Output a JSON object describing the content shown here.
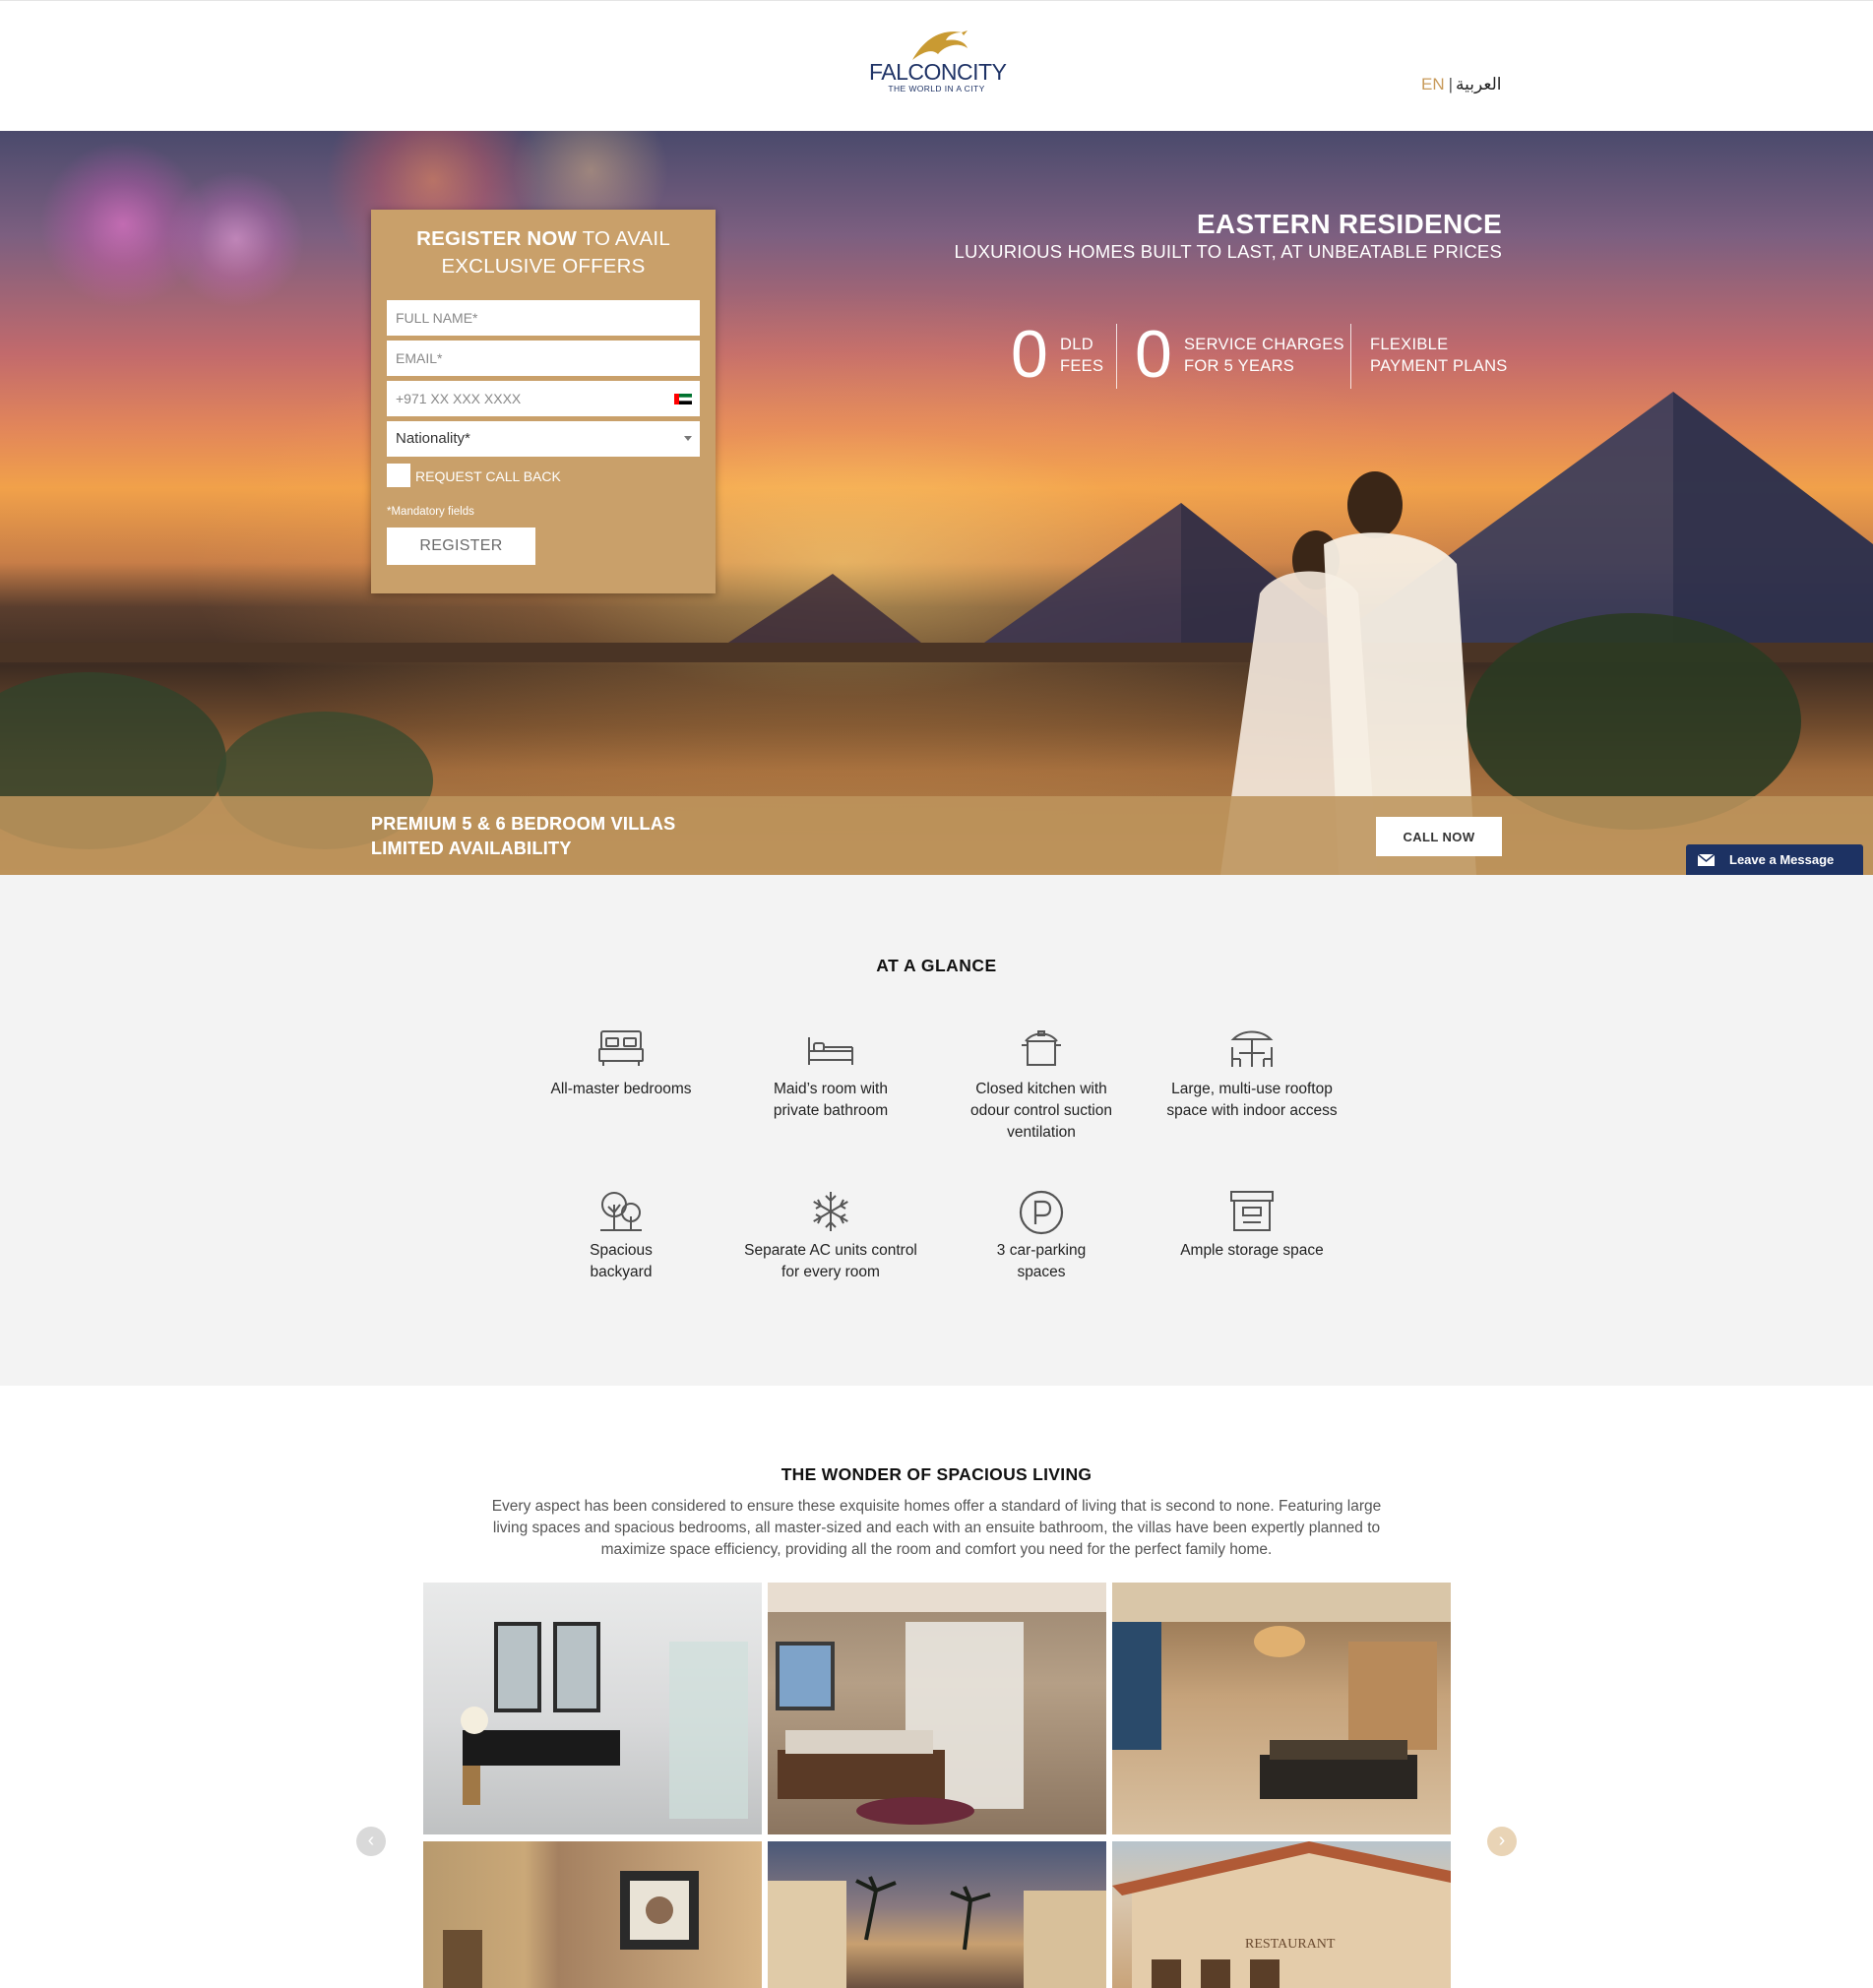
{
  "header": {
    "logo_name": "FALCONCITY",
    "logo_tagline": "THE WORLD IN A CITY",
    "lang_en": "EN",
    "lang_ar": "العربية"
  },
  "form": {
    "title_bold": "REGISTER NOW",
    "title_rest": " TO AVAIL EXCLUSIVE OFFERS",
    "fullname_placeholder": "FULL NAME*",
    "email_placeholder": "EMAIL*",
    "phone_placeholder": "+971 XX XXX XXXX",
    "nationality_selected": "Nationality*",
    "callback_label": "REQUEST CALL BACK",
    "mandatory_note": "*Mandatory fields",
    "submit_label": "REGISTER"
  },
  "hero": {
    "title": "EASTERN RESIDENCE",
    "subtitle": "LUXURIOUS HOMES BUILT TO LAST, AT UNBEATABLE PRICES",
    "stats": [
      {
        "num": "0",
        "line1": "DLD",
        "line2": "FEES"
      },
      {
        "num": "0",
        "line1": "SERVICE CHARGES",
        "line2": "FOR 5 YEARS"
      },
      {
        "num": "",
        "line1": "FLEXIBLE",
        "line2": "PAYMENT PLANS"
      }
    ],
    "band_line1": "PREMIUM 5 & 6 BEDROOM VILLAS",
    "band_line2": "LIMITED AVAILABILITY",
    "call_label": "CALL NOW",
    "leave_message": "Leave a Message"
  },
  "glance": {
    "title": "AT A GLANCE",
    "features": [
      {
        "icon": "bed-icon",
        "line1": "All-master bedrooms",
        "line2": "",
        "line3": ""
      },
      {
        "icon": "single-bed-icon",
        "line1": "Maid’s room with",
        "line2": "private bathroom",
        "line3": ""
      },
      {
        "icon": "cooking-pot-icon",
        "line1": "Closed kitchen with",
        "line2": "odour control suction",
        "line3": "ventilation"
      },
      {
        "icon": "rooftop-table-icon",
        "line1": "Large, multi-use rooftop",
        "line2": "space with indoor access",
        "line3": ""
      },
      {
        "icon": "trees-icon",
        "line1": "Spacious",
        "line2": "backyard",
        "line3": ""
      },
      {
        "icon": "snowflake-icon",
        "line1": "Separate AC units control",
        "line2": "for every room",
        "line3": ""
      },
      {
        "icon": "parking-icon",
        "line1": "3 car-parking",
        "line2": "spaces",
        "line3": ""
      },
      {
        "icon": "storage-box-icon",
        "line1": "Ample storage space",
        "line2": "",
        "line3": ""
      }
    ]
  },
  "wonder": {
    "title": "THE WONDER OF SPACIOUS LIVING",
    "text": "Every aspect has been considered to ensure these exquisite homes offer a standard of living that is second to none. Featuring large living spaces and spacious bedrooms, all master-sized and each with an ensuite bathroom, the villas have been expertly planned to maximize space efficiency, providing all the room and comfort you need for the perfect family home.",
    "arrow_prev": "‹",
    "arrow_next": "›",
    "restaurant_sign": "RESTAURANT"
  },
  "colors": {
    "gold": "#c9a06a",
    "navy": "#1d3263",
    "glance_bg": "#f3f3f3"
  }
}
